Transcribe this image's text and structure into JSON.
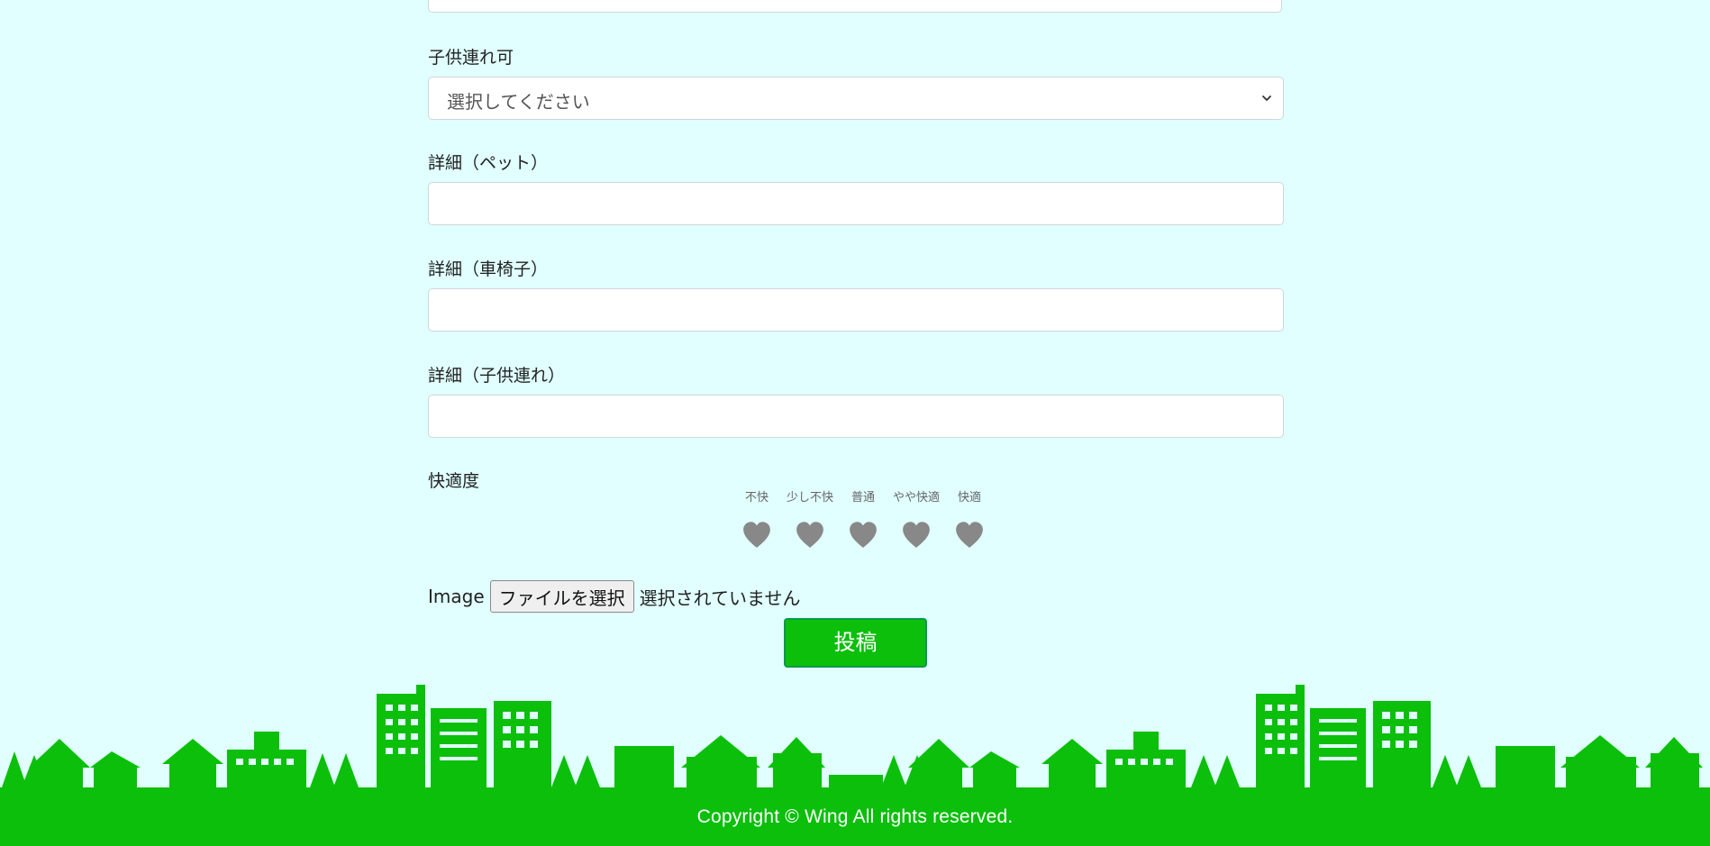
{
  "form": {
    "child_label": "子供連れ可",
    "child_select_value": "選択してください",
    "detail_pet_label": "詳細（ペット）",
    "detail_pet_value": "",
    "detail_wheelchair_label": "詳細（車椅子）",
    "detail_wheelchair_value": "",
    "detail_child_label": "詳細（子供連れ）",
    "detail_child_value": "",
    "comfort_label": "快適度",
    "comfort_options": [
      "不快",
      "少し不快",
      "普通",
      "やや快適",
      "快適"
    ],
    "comfort_selected": 0,
    "image_label": "Image",
    "file_button_label": "ファイルを選択",
    "file_status": "選択されていません",
    "submit_label": "投稿"
  },
  "footer": {
    "copyright": "Copyright © Wing All rights reserved."
  },
  "colors": {
    "background": "#e0fffe",
    "brand_green": "#0bbf0b",
    "heart_gray": "#888888"
  },
  "icons": {
    "rating": "heart-icon",
    "select": "chevron-down-icon"
  }
}
